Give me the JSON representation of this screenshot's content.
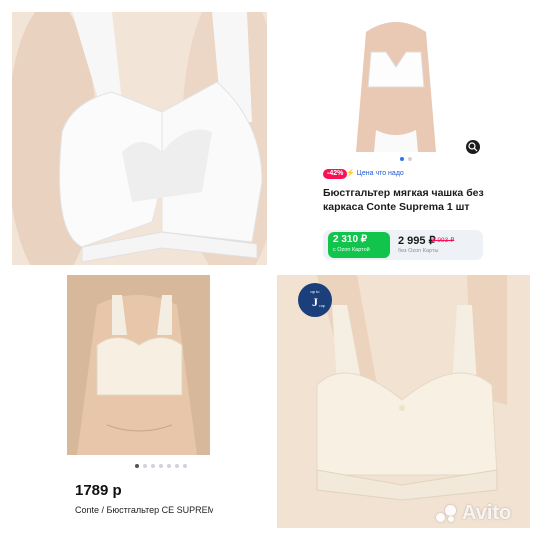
{
  "top_right_card": {
    "discount_badge": "-42%",
    "price_down_label": "Цена что надо",
    "title": "Бюстгальтер мягкая чашка без каркаса Conte Suprema 1 шт",
    "ozon_price": "2 310 ₽",
    "ozon_price_caption": "с Ozon Картой",
    "regular_price": "2 995 ₽",
    "old_price": "3 993 ₽",
    "without_card_caption": "без Ozon Карты"
  },
  "bottom_left_card": {
    "price": "1789 р",
    "name": "Conte / Бюстгальтер CE SUPREM"
  },
  "brand_badge": {
    "line1": "up to",
    "line2": "J",
    "line3": "cup"
  },
  "watermark": {
    "text": "Avito"
  },
  "colors": {
    "discount": "#f91155",
    "ozon_green": "#10c44c",
    "link_blue": "#1f5bd6",
    "badge_navy": "#1b3f7a"
  }
}
